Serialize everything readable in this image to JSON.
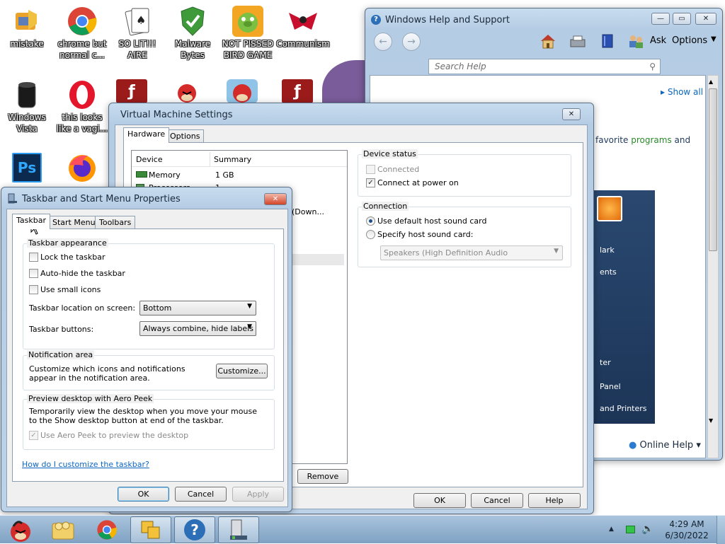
{
  "desktop": {
    "icons": [
      {
        "label": "mistake"
      },
      {
        "label": "chrome but normal c..."
      },
      {
        "label": "SO LIT!!! AIRE"
      },
      {
        "label": "Malware Bytes"
      },
      {
        "label": "NOT PISSED BIRD GAME"
      },
      {
        "label": "Communism"
      },
      {
        "label": "Windows Vista"
      },
      {
        "label": "this looks like a vagi..."
      }
    ],
    "ps_label": "Ps"
  },
  "help_window": {
    "title": "Windows Help and Support",
    "ask_label": "Ask",
    "options_label": "Options",
    "search_placeholder": "Search Help",
    "show_all": "Show all",
    "fragment_text": "favorite",
    "fragment_link": "programs",
    "fragment_and": "and",
    "side_items": [
      "lark",
      "ents",
      "ter",
      "Panel",
      "and Printers"
    ],
    "online_help": "Online Help"
  },
  "vm_settings": {
    "title": "Virtual Machine Settings",
    "tabs": [
      "Hardware",
      "Options"
    ],
    "columns": [
      "Device",
      "Summary"
    ],
    "rows": [
      {
        "device": "Memory",
        "summary": "1 GB"
      },
      {
        "device": "Processors",
        "summary": "1"
      }
    ],
    "partial_text": "(Down...",
    "device_status_label": "Device status",
    "connected_label": "Connected",
    "connect_power_label": "Connect at power on",
    "connection_label": "Connection",
    "default_sound_label": "Use default host sound card",
    "specify_sound_label": "Specify host sound card:",
    "sound_card_value": "Speakers (High Definition Audio",
    "remove_button": "Remove",
    "ok_button": "OK",
    "cancel_button": "Cancel",
    "help_button": "Help"
  },
  "taskbar_props": {
    "title": "Taskbar and Start Menu Properties",
    "tabs": [
      "Taskbar",
      "Start Menu",
      "Toolbars"
    ],
    "appearance_label": "Taskbar appearance",
    "lock_label": "Lock the taskbar",
    "autohide_label": "Auto-hide the taskbar",
    "small_icons_label": "Use small icons",
    "location_label": "Taskbar location on screen:",
    "location_value": "Bottom",
    "buttons_label": "Taskbar buttons:",
    "buttons_value": "Always combine, hide labels",
    "notification_label": "Notification area",
    "notification_text": "Customize which icons and notifications appear in the notification area.",
    "customize_button": "Customize...",
    "aero_label": "Preview desktop with Aero Peek",
    "aero_text": "Temporarily view the desktop when you move your mouse to the Show desktop button at end of the taskbar.",
    "aero_checkbox_label": "Use Aero Peek to preview the desktop",
    "help_link": "How do I customize the taskbar?",
    "ok_button": "OK",
    "cancel_button": "Cancel",
    "apply_button": "Apply"
  },
  "taskbar": {
    "time": "4:29 AM",
    "date": "6/30/2022"
  },
  "colors": {
    "accent": "#1d4d84",
    "link": "#0b66c2",
    "close_red": "#d3452a",
    "taskbar": "#8fb0ce"
  }
}
